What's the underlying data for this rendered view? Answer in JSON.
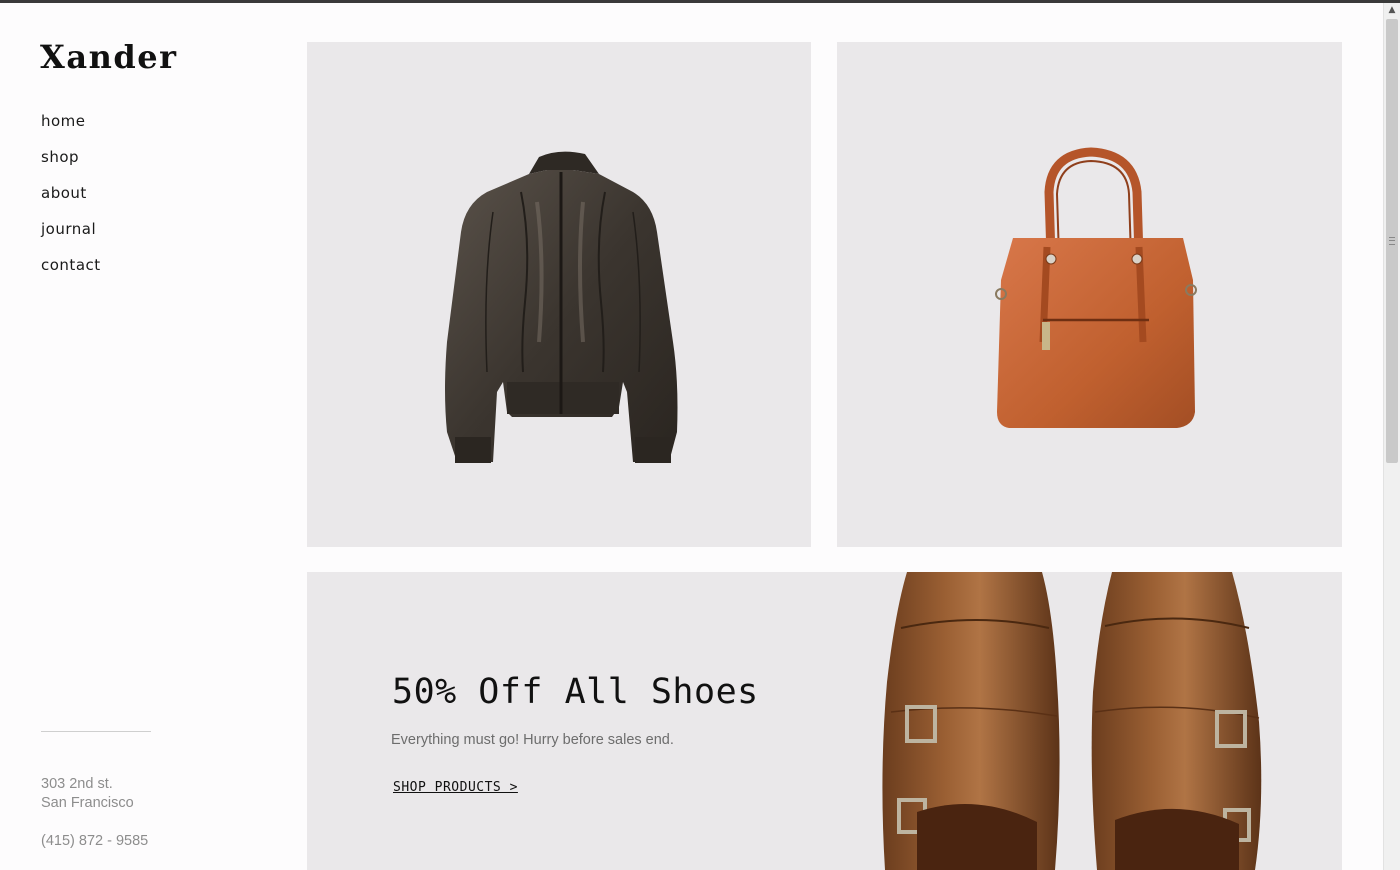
{
  "brand": {
    "logo": "Xander"
  },
  "nav": {
    "items": [
      {
        "label": "home"
      },
      {
        "label": "shop"
      },
      {
        "label": "about"
      },
      {
        "label": "journal"
      },
      {
        "label": "contact"
      }
    ]
  },
  "footer": {
    "address_line1": "303 2nd st.",
    "address_line2": "San Francisco",
    "phone": "(415) 872 - 9585"
  },
  "products": [
    {
      "icon": "leather-jacket-image"
    },
    {
      "icon": "leather-handbag-image"
    }
  ],
  "promo": {
    "title": "50% Off All Shoes",
    "subtitle": "Everything must go! Hurry before sales end.",
    "link_label": "SHOP PRODUCTS >",
    "icon": "brown-monk-shoes-image"
  },
  "colors": {
    "tile_background": "#eae8ea",
    "page_background": "#fdfcfd",
    "text_primary": "#111111",
    "text_muted": "#8d8d8d"
  }
}
